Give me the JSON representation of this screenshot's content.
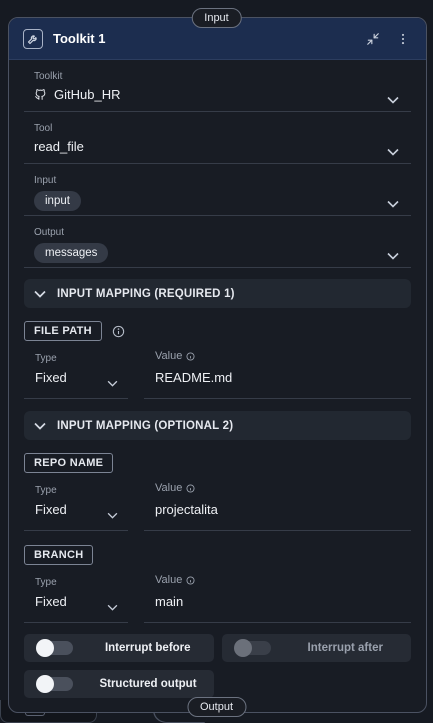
{
  "input_handle": "Input",
  "output_handle": "Output",
  "node": {
    "title": "Toolkit 1",
    "icon": "wrench-icon",
    "header_actions": [
      "collapse-icon",
      "more-vertical-icon"
    ]
  },
  "fields": {
    "toolkit": {
      "label": "Toolkit",
      "value": "GitHub_HR",
      "icon": "github-icon"
    },
    "tool": {
      "label": "Tool",
      "value": "read_file"
    },
    "input": {
      "label": "Input",
      "value": "input"
    },
    "output": {
      "label": "Output",
      "value": "messages"
    }
  },
  "required_section": {
    "title": "INPUT MAPPING (REQUIRED 1)",
    "params": [
      {
        "name": "FILE PATH",
        "type_label": "Type",
        "type_value": "Fixed",
        "value_label": "Value",
        "value": "README.md"
      }
    ]
  },
  "optional_section": {
    "title": "INPUT MAPPING (OPTIONAL 2)",
    "params": [
      {
        "name": "REPO NAME",
        "type_label": "Type",
        "type_value": "Fixed",
        "value_label": "Value",
        "value": "projectalita"
      },
      {
        "name": "BRANCH",
        "type_label": "Type",
        "type_value": "Fixed",
        "value_label": "Value",
        "value": "main"
      }
    ]
  },
  "toggles": {
    "interrupt_before": {
      "label": "Interrupt before",
      "on": false
    },
    "interrupt_after": {
      "label": "Interrupt after",
      "on": false,
      "disabled": true
    },
    "structured_output": {
      "label": "Structured output",
      "on": false
    }
  },
  "colors": {
    "header_bg": "#1c2d4f",
    "node_bg": "#181c24",
    "border": "#4b5262"
  }
}
